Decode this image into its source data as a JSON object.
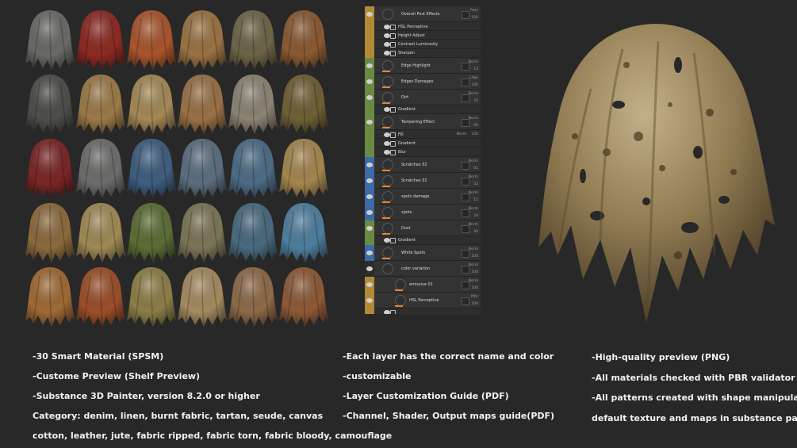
{
  "grid": {
    "rows": [
      [
        "#6a6a68",
        "#8c2a22",
        "#a9552d",
        "#9a7343",
        "#6e6548",
        "#8a5a33"
      ],
      [
        "#4e4e4c",
        "#9c7a48",
        "#a58957",
        "#9b7146",
        "#8c8474",
        "#6f6036"
      ],
      [
        "#7b2626",
        "#6d6d6c",
        "#3f5e80",
        "#5c6e7e",
        "#4e6c86",
        "#a58650"
      ],
      [
        "#8c6a3e",
        "#a08a55",
        "#5c6e36",
        "#7c7658",
        "#4a6a80",
        "#4f7f9e"
      ],
      [
        "#a06a36",
        "#9c4f2a",
        "#8d7e48",
        "#a48a60",
        "#8e6a48",
        "#8e5a38"
      ]
    ]
  },
  "panel": {
    "layers": [
      {
        "name": "Overall Post Effects",
        "strip": "#b08a37",
        "kind": "folder",
        "blend": "Pass",
        "opacity": "100"
      },
      {
        "name": "HSL Perceptive",
        "strip": "#b08a37",
        "kind": "effect"
      },
      {
        "name": "Height Adjust",
        "strip": "#b08a37",
        "kind": "effect"
      },
      {
        "name": "Contrast Luminosity",
        "strip": "#b08a37",
        "kind": "effect"
      },
      {
        "name": "Sharpen",
        "strip": "#b08a37",
        "kind": "effect"
      },
      {
        "name": "Edge Highlight",
        "strip": "#6a8a42",
        "kind": "layer",
        "blend": "Norm",
        "opacity": "12"
      },
      {
        "name": "Edges Damages",
        "strip": "#6a8a42",
        "kind": "layer",
        "blend": "Ldge",
        "opacity": "100"
      },
      {
        "name": "Dirt",
        "strip": "#6a8a42",
        "kind": "layer",
        "blend": "Norm",
        "opacity": "74"
      },
      {
        "name": "Gradient",
        "strip": "#6a8a42",
        "kind": "effect"
      },
      {
        "name": "Tempering Effect",
        "strip": "#6a8a42",
        "kind": "layer",
        "blend": "Norm",
        "opacity": "60"
      },
      {
        "name": "Fill",
        "strip": "#6a8a42",
        "kind": "fill",
        "blend": "Norm",
        "opacity": "100"
      },
      {
        "name": "Gradient",
        "strip": "#6a8a42",
        "kind": "effect"
      },
      {
        "name": "Blur",
        "strip": "#6a8a42",
        "kind": "effect"
      },
      {
        "name": "Scratches 02",
        "strip": "#3d6aa8",
        "kind": "layer",
        "blend": "Norm",
        "opacity": "61"
      },
      {
        "name": "Scratches 01",
        "strip": "#3d6aa8",
        "kind": "layer",
        "blend": "Norm",
        "opacity": "52"
      },
      {
        "name": "spots damage",
        "strip": "#3d6aa8",
        "kind": "layer",
        "blend": "Norm",
        "opacity": "15"
      },
      {
        "name": "spots",
        "strip": "#3d6aa8",
        "kind": "layer",
        "blend": "Norm",
        "opacity": "24"
      },
      {
        "name": "Dust",
        "strip": "#6a8a42",
        "kind": "layer",
        "blend": "Norm",
        "opacity": "44"
      },
      {
        "name": "Gradient",
        "strip": "#6a8a42",
        "kind": "effect"
      },
      {
        "name": "White Spots",
        "strip": "#3d6aa8",
        "kind": "layer",
        "blend": "Norm",
        "opacity": "100"
      },
      {
        "name": "color variation",
        "strip": "#2c2c2c",
        "kind": "folder",
        "blend": "Norm",
        "opacity": "100"
      },
      {
        "name": "emissive 01",
        "strip": "#b08a37",
        "kind": "sublayer",
        "blend": "Norm",
        "opacity": "100"
      },
      {
        "name": "HSL Perceptive",
        "strip": "#b08a37",
        "kind": "sublayer",
        "blend": "Pthr",
        "opacity": "100"
      },
      {
        "name": "",
        "strip": "#b08a37",
        "kind": "effect"
      }
    ]
  },
  "text": {
    "col1": [
      "-30 Smart Material  (SPSM)",
      "-Custome Preview (Shelf Preview)",
      "-Substance 3D Painter, version 8.2.0 or higher",
      "Category: denim, linen, burnt fabric, tartan, seude, canvas",
      "cotton, leather, jute, fabric ripped, fabric torn, fabric bloody, camouflage"
    ],
    "col2": [
      "-Each layer has the correct name and color",
      "-customizable",
      "-Layer Customization Guide (PDF)",
      "-Channel, Shader, Output maps guide(PDF)"
    ],
    "col3": [
      "-High-quality preview (PNG)",
      "-All materials checked with PBR validator",
      "-All patterns created with shape manipulation using",
      "default texture and maps in substance painter"
    ]
  },
  "hero": {
    "fabric": "#8a7652",
    "light": "#b6a37a",
    "dark": "#3a2d1c"
  }
}
